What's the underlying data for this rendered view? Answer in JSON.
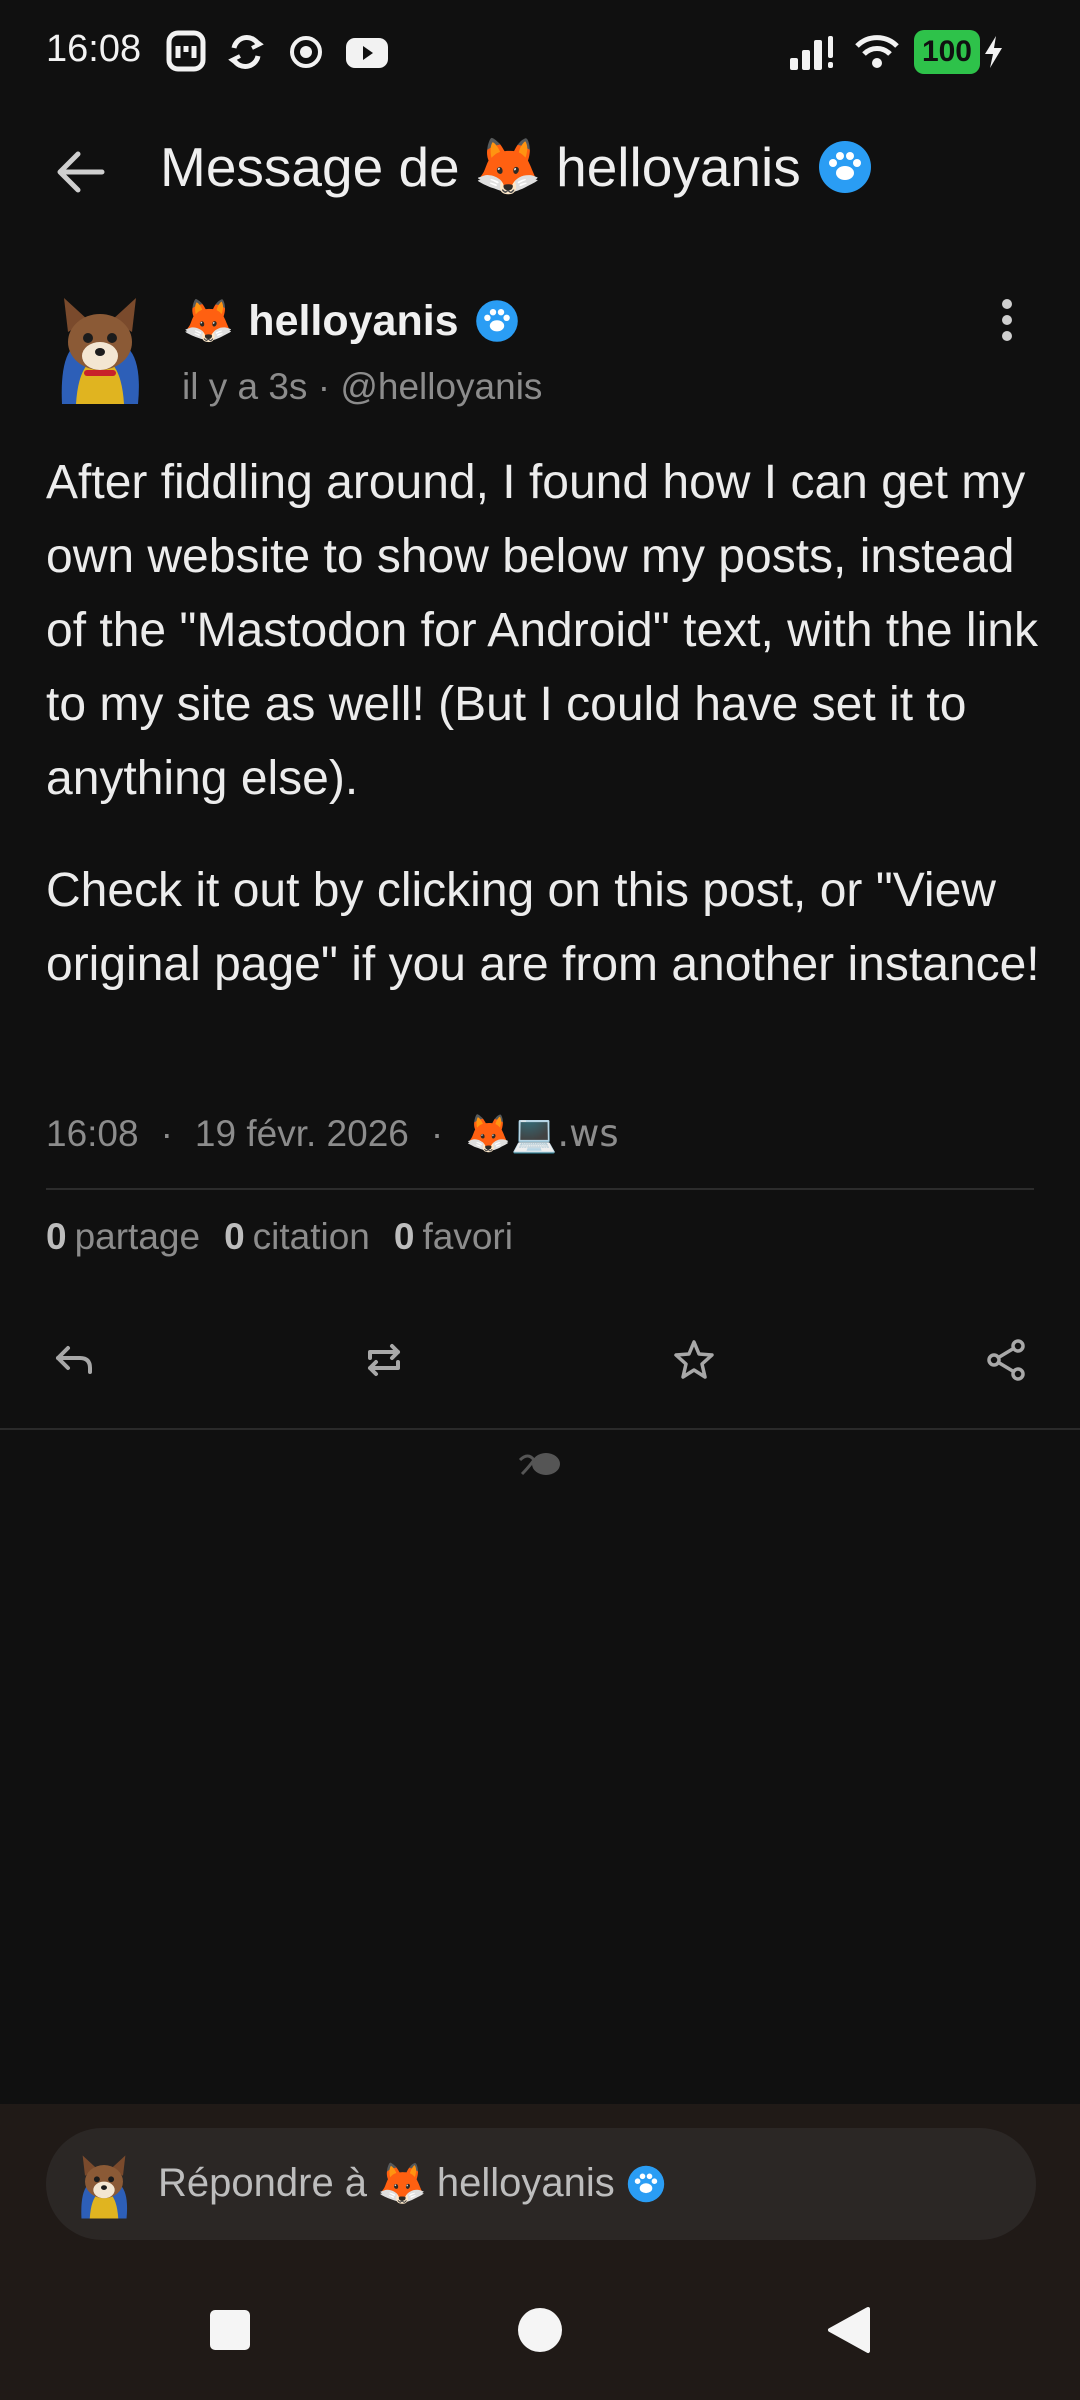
{
  "status_bar": {
    "time": "16:08",
    "battery": "100",
    "icons": [
      "mastodon-icon",
      "sync-icon",
      "record-icon",
      "youtube-icon",
      "signal-icon",
      "wifi-icon",
      "battery-icon"
    ]
  },
  "app_bar": {
    "title_prefix": "Message de",
    "title_emoji": "🦊",
    "title_name": "helloyanis",
    "back_icon": "arrow-left-icon"
  },
  "post": {
    "author_emoji": "🦊",
    "author_name": "helloyanis",
    "meta": "il y a 3s · @helloyanis",
    "paragraphs": [
      "After fiddling around, I found how I can get my own website to show below my posts, instead of the \"Mastodon for Android\" text, with the link to my site as well! (But I could have set it to anything else).",
      "Check it out by clicking on this post, or \"View original page\" if you are from another instance!"
    ],
    "time": "16:08",
    "sep": "·",
    "date": "19 févr. 2026",
    "source": "🦊💻.ws",
    "stats": {
      "reblogs_count": "0",
      "reblogs_label": "partage",
      "quotes_count": "0",
      "quotes_label": "citation",
      "favs_count": "0",
      "favs_label": "favori"
    }
  },
  "reply": {
    "prefix": "Répondre à",
    "emoji": "🦊",
    "name": "helloyanis"
  },
  "colors": {
    "background": "#101010",
    "accent_badge": "#2a9df4",
    "battery": "#2ec24a",
    "reply_bar": "#201a17"
  }
}
